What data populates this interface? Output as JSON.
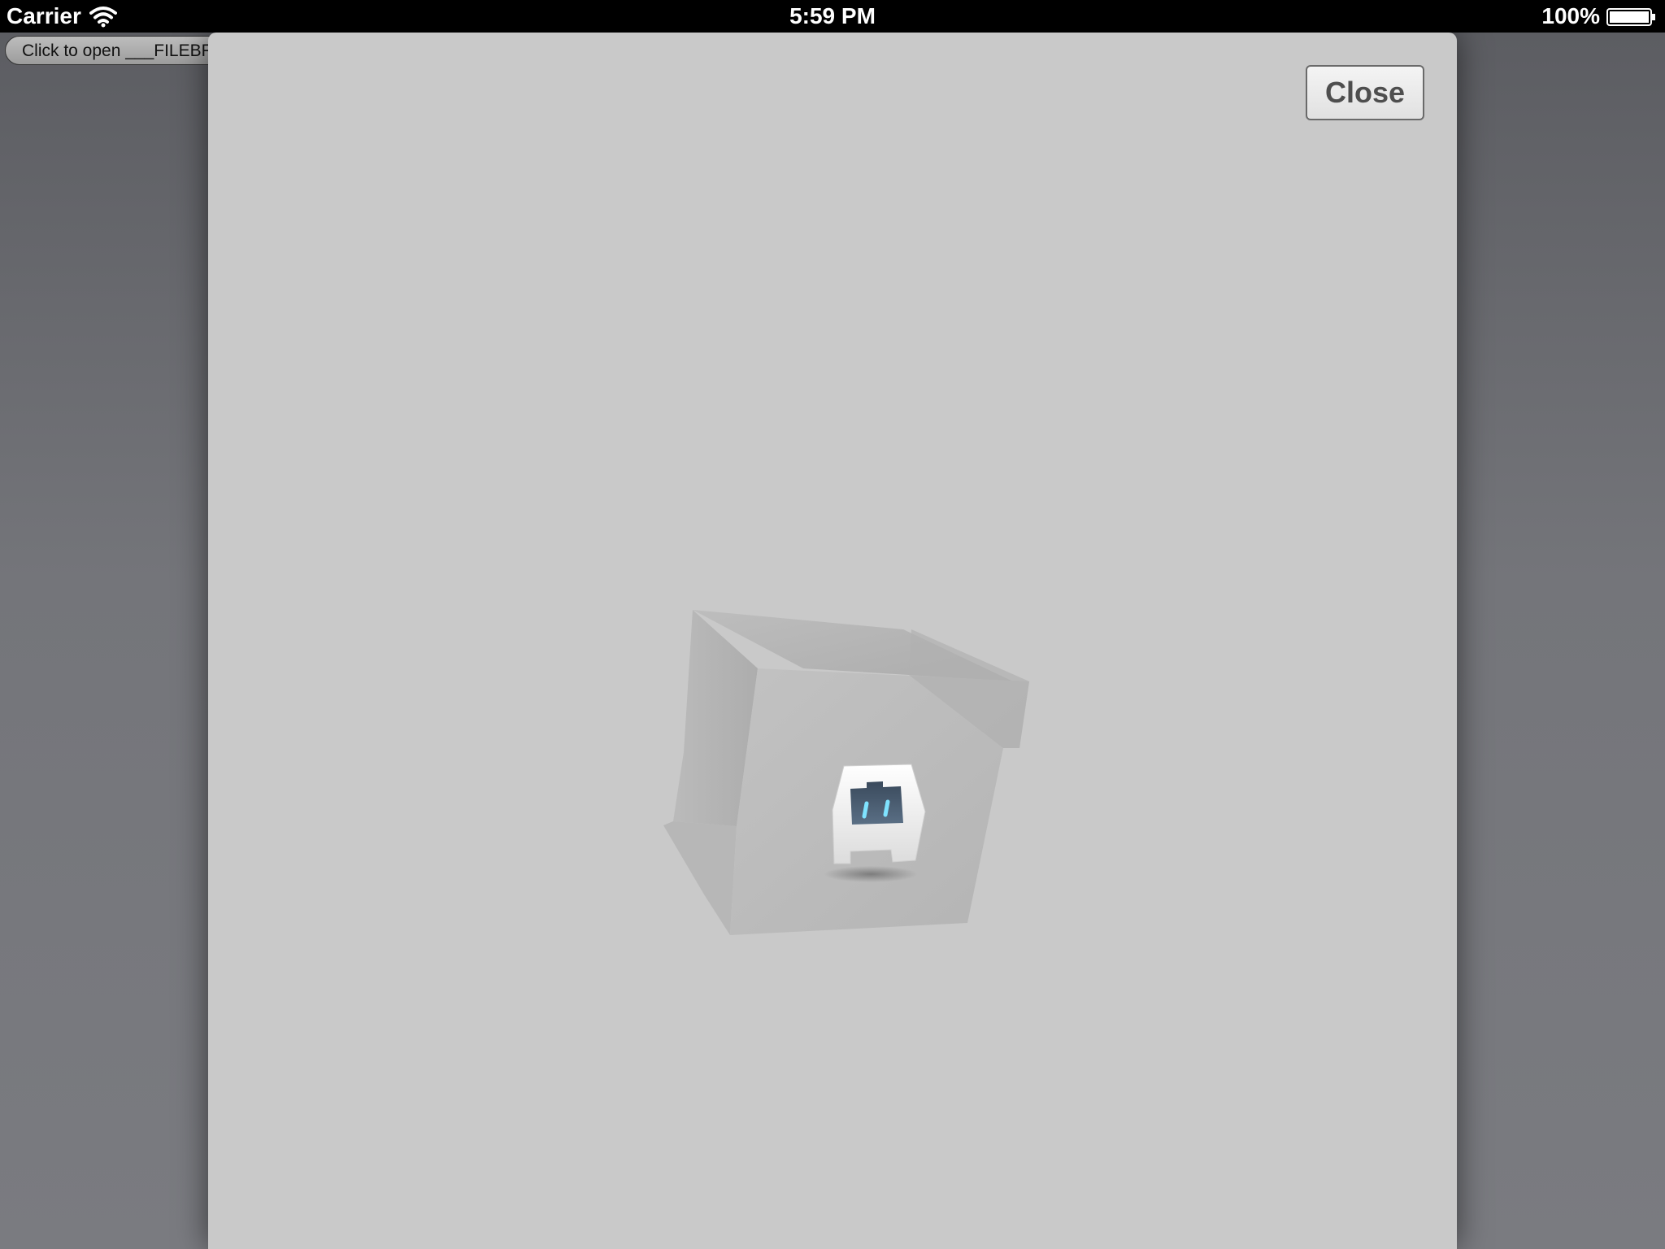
{
  "status_bar": {
    "carrier": "Carrier",
    "time": "5:59 PM",
    "battery": "100%"
  },
  "background": {
    "open_button_label": "Click to open ___FILEBROWSER___"
  },
  "modal": {
    "close_label": "Close"
  },
  "icons": {
    "wifi": "wifi-icon",
    "battery": "battery-icon",
    "cube": "cube-graphic",
    "logo": "cordova-logo-icon"
  },
  "colors": {
    "status_bar": "#000000",
    "modal_background": "#c9c9c9",
    "dimmed_background": "#6f7075"
  }
}
